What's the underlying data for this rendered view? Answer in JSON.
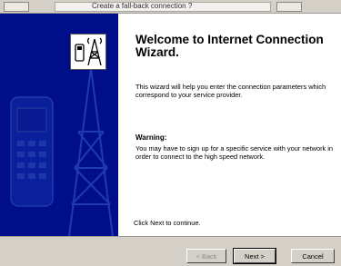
{
  "top_strip": {
    "label": "Create a fall-back connection ?"
  },
  "wizard": {
    "title": "Welcome to Internet Connection Wizard.",
    "intro": "This wizard will help you enter the connection parameters which correspond to your service provider.",
    "warning_heading": "Warning:",
    "warning_text": "You may have to sign up for a specific service with your network in order to connect to the high speed network.",
    "continue_note": "Click Next to continue.",
    "banner_icon": "phone-tower-icon"
  },
  "buttons": {
    "back": "< Back",
    "next": "Next >",
    "cancel": "Cancel"
  },
  "colors": {
    "banner": "#000e8a",
    "dialog": "#d4d0c8"
  }
}
